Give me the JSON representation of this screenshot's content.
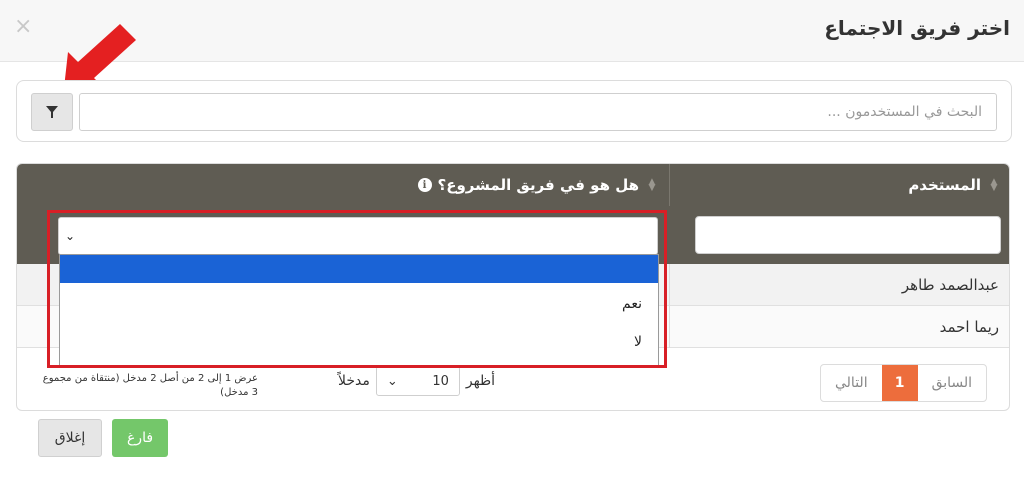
{
  "modal": {
    "title": "اختر فريق الاجتماع",
    "close_symbol": "×"
  },
  "search": {
    "placeholder": "البحث في المستخدمون ...",
    "filter_icon": "filter-icon"
  },
  "table": {
    "columns": [
      {
        "label": "المستخدم",
        "sort_icon": "sort-icon"
      },
      {
        "label": "هل هو في فريق المشروع؟",
        "info_icon": "info-icon",
        "sort_icon": "sort-icon"
      }
    ],
    "rows": [
      {
        "user": "عبدالصمد طاهر"
      },
      {
        "user": "ريما احمد"
      }
    ]
  },
  "team_filter_dropdown": {
    "selected": "",
    "options": [
      "",
      "نعم",
      "لا"
    ]
  },
  "footer": {
    "info": "عرض 1 إلى 2 من أصل 2 مدخل (منتقاة من مجموع 3 مدخل)",
    "show_label": "أظهر",
    "entries_label": "مدخلاً",
    "page_length": "10",
    "pagination": {
      "previous": "السابق",
      "current_page": "1",
      "next": "التالي"
    }
  },
  "buttons": {
    "clear": "فارغ",
    "close": "إغلاق"
  },
  "colors": {
    "header_bg": "#5f5c53",
    "active_page": "#ed6d3c",
    "clear_button": "#74c76a",
    "selected_option": "#1a63d6",
    "annotation_red": "#d81f26"
  }
}
